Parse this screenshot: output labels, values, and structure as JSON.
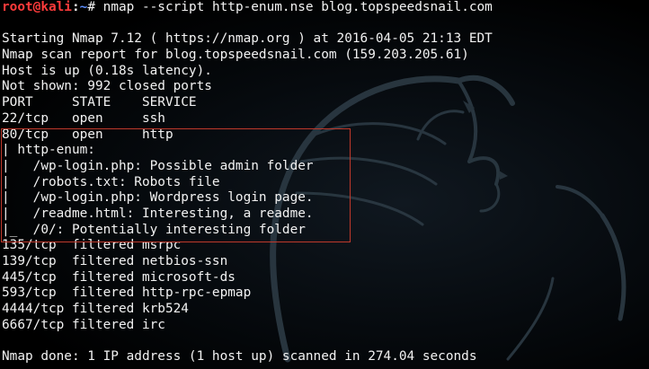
{
  "prompt": {
    "user_host": "root@kali",
    "separator": ":",
    "path": "~",
    "symbol": "# ",
    "command": "nmap --script http-enum.nse blog.topspeedsnail.com"
  },
  "output_lines": [
    "",
    "Starting Nmap 7.12 ( https://nmap.org ) at 2016-04-05 21:13 EDT",
    "Nmap scan report for blog.topspeedsnail.com (159.203.205.61)",
    "Host is up (0.18s latency).",
    "Not shown: 992 closed ports",
    "PORT     STATE    SERVICE",
    "22/tcp   open     ssh",
    "80/tcp   open     http",
    "| http-enum:",
    "|   /wp-login.php: Possible admin folder",
    "|   /robots.txt: Robots file",
    "|   /wp-login.php: Wordpress login page.",
    "|   /readme.html: Interesting, a readme.",
    "|_  /0/: Potentially interesting folder",
    "135/tcp  filtered msrpc",
    "139/tcp  filtered netbios-ssn",
    "445/tcp  filtered microsoft-ds",
    "593/tcp  filtered http-rpc-epmap",
    "4444/tcp filtered krb524",
    "6667/tcp filtered irc",
    "",
    "Nmap done: 1 IP address (1 host up) scanned in 274.04 seconds"
  ],
  "colors": {
    "background": "#000000",
    "text": "#f2f2f2",
    "prompt_user": "#ff3b3b",
    "prompt_path": "#5f8fff",
    "highlight_border": "#c0392b"
  },
  "background_icon": "kali-dragon-icon"
}
